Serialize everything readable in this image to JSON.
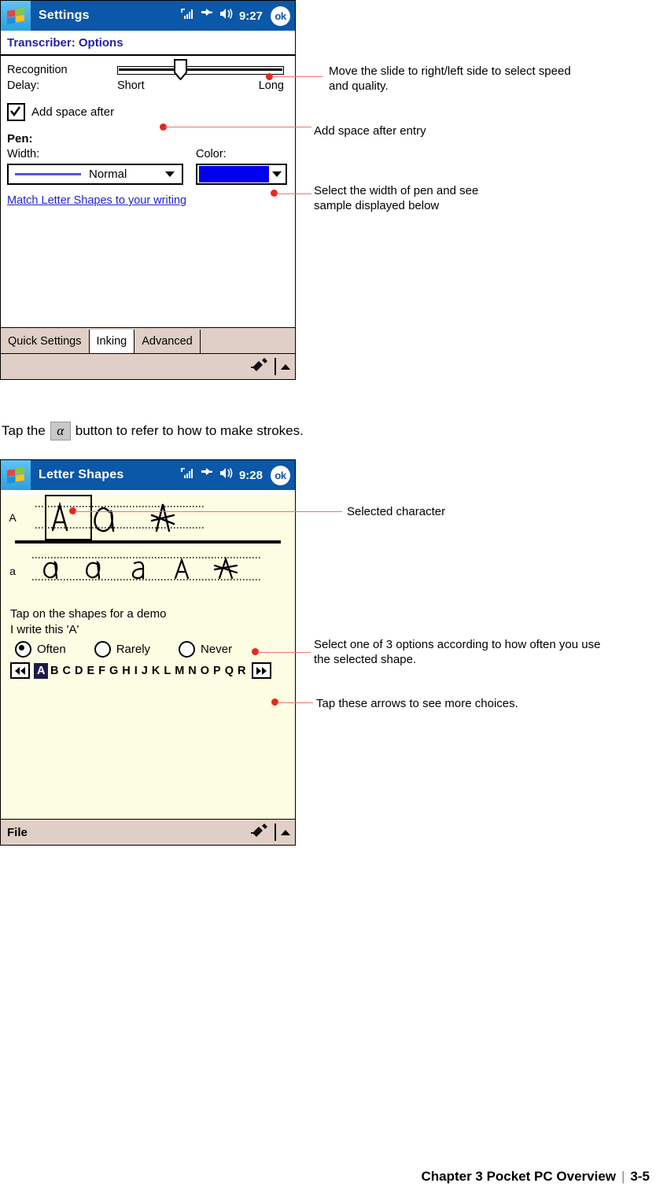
{
  "screen_settings": {
    "titlebar": {
      "app_title": "Settings",
      "time": "9:27",
      "ok_label": "ok",
      "icons": [
        "signal-icon",
        "connectivity-icon",
        "volume-icon"
      ]
    },
    "page_title": "Transcriber: Options",
    "recognition_delay": {
      "label": "Recognition\nDelay:",
      "min_label": "Short",
      "max_label": "Long",
      "value_percent": 36
    },
    "add_space": {
      "label": "Add space after",
      "checked": true
    },
    "pen": {
      "heading": "Pen:",
      "width_label": "Width:",
      "width_value": "Normal",
      "color_label": "Color:",
      "color_value": "#0000ee"
    },
    "match_link": "Match Letter Shapes to your writing",
    "tabs": [
      {
        "label": "Quick Settings",
        "active": false
      },
      {
        "label": "Inking",
        "active": true
      },
      {
        "label": "Advanced",
        "active": false
      }
    ],
    "command_bar": {
      "label": "",
      "icons": [
        "keyboard-input-icon",
        "up-caret-icon"
      ]
    }
  },
  "mid_instruction": {
    "before": "Tap the",
    "button_glyph": "α",
    "after": "button to refer to how to make strokes."
  },
  "screen_letters": {
    "titlebar": {
      "app_title": "Letter Shapes",
      "time": "9:28",
      "ok_label": "ok",
      "icons": [
        "signal-icon",
        "connectivity-icon",
        "volume-icon"
      ]
    },
    "upper_row_label": "A",
    "lower_row_label": "a",
    "selected_shape_index": 0,
    "hint": "Tap on the shapes for a demo\nI write this 'A'",
    "frequency_options": [
      {
        "label": "Often",
        "selected": true
      },
      {
        "label": "Rarely",
        "selected": false
      },
      {
        "label": "Never",
        "selected": false
      }
    ],
    "alphabet": [
      "A",
      "B",
      "C",
      "D",
      "E",
      "F",
      "G",
      "H",
      "I",
      "J",
      "K",
      "L",
      "M",
      "N",
      "O",
      "P",
      "Q",
      "R"
    ],
    "alphabet_selected": "A",
    "prev_arrow": "prev-arrows-icon",
    "next_arrow": "next-arrows-icon",
    "command_bar": {
      "label": "File",
      "icons": [
        "keyboard-input-icon",
        "up-caret-icon"
      ]
    }
  },
  "annotations": {
    "slider": "Move the slide to right/left side to select speed\nand quality.",
    "add_space": "Add space after entry",
    "pen_width": "Select the width of pen and see\nsample displayed below",
    "selected_char": "Selected character",
    "frequency": "Select one of 3 options according to how often you use\nthe selected shape.",
    "arrows": "Tap these arrows to see more choices."
  },
  "footer": {
    "chapter": "Chapter 3 Pocket PC Overview",
    "separator": "|",
    "page": "3-5"
  }
}
